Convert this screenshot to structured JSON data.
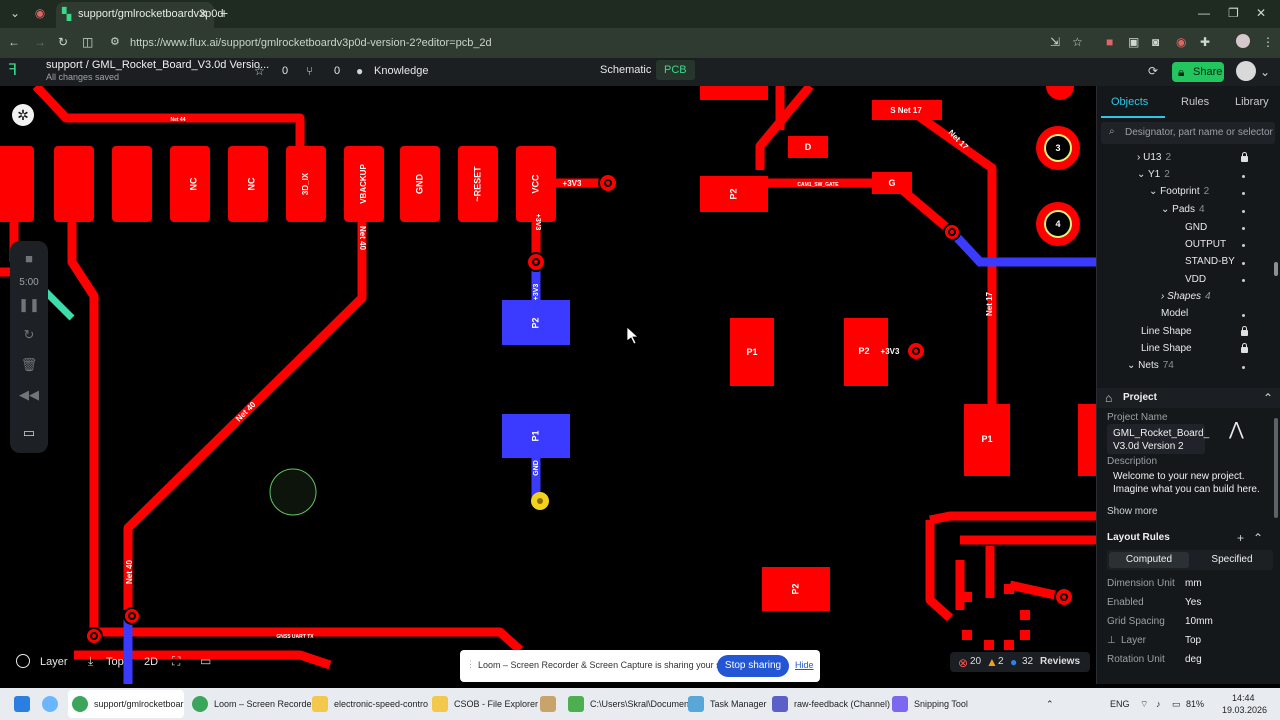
{
  "browser": {
    "tab_title": "support/gmlrocketboardv3p0d",
    "url": "https://www.flux.ai/support/gmlrocketboardv3p0d-version-2?editor=pcb_2d"
  },
  "app": {
    "breadcrumb": "support / GML_Rocket_Board_V3.0d Versio...",
    "saved_status": "All changes saved",
    "star_count": "0",
    "fork_count": "0",
    "knowledge_label": "Knowledge",
    "tabs": {
      "schematic": "Schematic",
      "pcb": "PCB"
    },
    "share_label": "Share"
  },
  "canvas": {
    "pads_top": [
      "NC",
      "NC",
      "3D_IX",
      "VBACKUP",
      "GND",
      "~RESET",
      "VCC"
    ],
    "labels": {
      "p3v3_a": "+3V3",
      "p3v3_b": "+3V3",
      "p3v3_c": "+3V3",
      "p3v3_d": "+3V3",
      "net40_a": "Net 40",
      "net40_b": "Net 40",
      "net40_c": "Net 40",
      "net17_a": "Net 17",
      "net17_b": "Net 17",
      "s_net17": "S Net 17",
      "cam1": "CAM1_SW_GATE",
      "gnss": "GNSS UART TX",
      "net44": "Net 44",
      "pad_d": "D",
      "pad_g": "G",
      "pad_p2a": "P2",
      "pad_p2b": "P2",
      "pad_p2c": "P2",
      "pad_p2d": "P2",
      "pad_p1a": "P1",
      "pad_p1b": "P1",
      "pad_p1c": "P1",
      "gnd_lbl": "GND",
      "mh3": "3",
      "mh4": "4"
    },
    "bottom_tools": {
      "layer": "Layer",
      "top": "Top",
      "view": "2D"
    },
    "loom_timer": "5:00"
  },
  "share_notice": {
    "message": "Loom – Screen Recorder & Screen Capture is sharing your screen.",
    "stop": "Stop sharing",
    "hide": "Hide"
  },
  "reviews": {
    "errors": "20",
    "warnings": "2",
    "info": "32",
    "label": "Reviews"
  },
  "right_panel": {
    "tabs": {
      "objects": "Objects",
      "rules": "Rules",
      "library": "Library"
    },
    "search_placeholder": "Designator, part name or selector",
    "tree": [
      {
        "label": "U13",
        "count": "2"
      },
      {
        "label": "Y1",
        "count": "2"
      },
      {
        "label": "Footprint",
        "count": "2"
      },
      {
        "label": "Pads",
        "count": "4"
      },
      {
        "label": "GND"
      },
      {
        "label": "OUTPUT"
      },
      {
        "label": "STAND-BY"
      },
      {
        "label": "VDD"
      },
      {
        "label": "Shapes",
        "count": "4"
      },
      {
        "label": "Model"
      },
      {
        "label": "Line Shape"
      },
      {
        "label": "Line Shape"
      },
      {
        "label": "Nets",
        "count": "74"
      }
    ],
    "project": {
      "header": "Project",
      "name_label": "Project Name",
      "name_value": "GML_Rocket_Board_ V3.0d Version 2",
      "description_label": "Description",
      "description": "Welcome to your new project. Imagine what you can build here.",
      "show_more": "Show more"
    },
    "layout_rules": {
      "header": "Layout Rules",
      "computed": "Computed",
      "specified": "Specified",
      "rows": [
        {
          "key": "Dimension Unit",
          "value": "mm"
        },
        {
          "key": "Enabled",
          "value": "Yes"
        },
        {
          "key": "Grid Spacing",
          "value": "10mm"
        },
        {
          "key": "Layer",
          "value": "Top"
        },
        {
          "key": "Rotation Unit",
          "value": "deg"
        }
      ]
    }
  },
  "taskbar": {
    "items": [
      "support/gmlrocketboar",
      "Loom – Screen Recorde",
      "electronic-speed-contro",
      "CSOB - File Explorer",
      "C:\\Users\\Skral\\Documen",
      "Task Manager",
      "raw-feedback (Channel)",
      "Snipping Tool"
    ],
    "lang": "ENG",
    "battery": "81%",
    "time": "14:44",
    "date": "19.03.2026"
  },
  "colors": {
    "copper_top": "#ff0000",
    "copper_bottom": "#3b3bff",
    "accent": "#22c55e",
    "panel_accent": "#2ec6e6"
  }
}
